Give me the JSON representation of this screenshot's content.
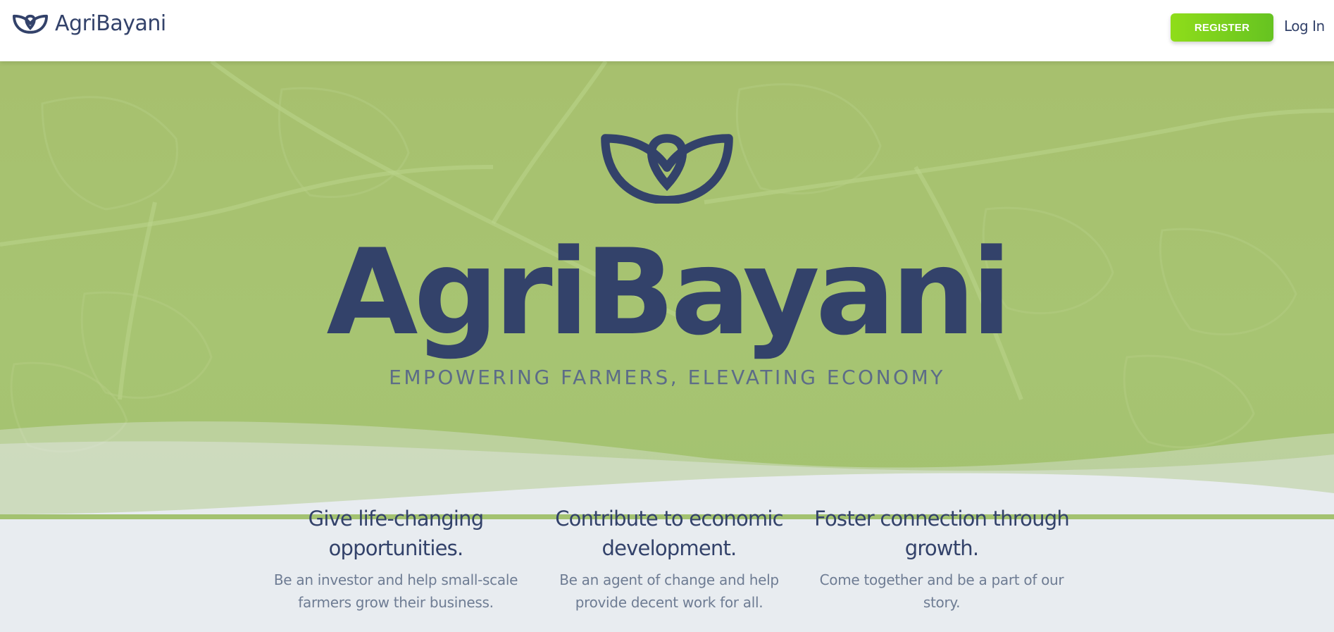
{
  "nav": {
    "brand": "AgriBayani",
    "register_label": "REGISTER",
    "login_label": "Log In",
    "logo_icon": "leaf-logo-icon"
  },
  "hero": {
    "title": "AgriBayani",
    "tagline": "EMPOWERING FARMERS, ELEVATING ECONOMY",
    "logo_icon": "leaf-logo-icon"
  },
  "features": [
    {
      "title_line1": "Give life-changing",
      "title_line2": "opportunities.",
      "desc_line1": "Be an investor and help small-scale",
      "desc_line2": "farmers grow their business."
    },
    {
      "title_line1": "Contribute to economic",
      "title_line2": "development.",
      "desc_line1": "Be an agent of change and help",
      "desc_line2": "provide decent work for all."
    },
    {
      "title_line1": "Foster connection through",
      "title_line2": "growth.",
      "desc_line1": "Come together and be a part of our",
      "desc_line2": "story."
    }
  ],
  "colors": {
    "brand_navy": "#33426a",
    "register_green": "#7ed321",
    "hero_green": "#a7c06e",
    "section_bg": "#e8ecf0"
  }
}
